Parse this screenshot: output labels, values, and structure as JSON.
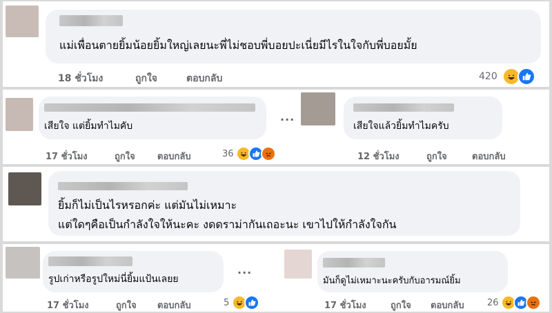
{
  "comments": [
    {
      "text": "แม่เพื่อนตายยิ้มน้อยยิ้มใหญ่เลยนะพี่ไม่ชอบพี่บอยปะเนี่ยมีไรในใจกับพี่บอยมั้ย",
      "time": "18 ชั่วโมง",
      "like": "ถูกใจ",
      "reply": "ตอบกลับ",
      "count": "420",
      "reactions": [
        "haha-icon",
        "like-icon"
      ]
    },
    {
      "text": "เสียใจ แต่ยิ้มทำไมคับ",
      "time": "17 ชั่วโมง",
      "like": "ถูกใจ",
      "reply": "ตอบกลับ",
      "count": "36",
      "reactions": [
        "haha-icon",
        "like-icon",
        "angry-icon"
      ]
    },
    {
      "text": "เสียใจแล้วยิ้มทำไมครับ",
      "time": "12 ชั่วโมง",
      "like": "ถูกใจ",
      "reply": "ตอบกลับ"
    },
    {
      "lines": [
        "ยิ้มก็ไม่เป็นไรหรอกค่ะ แต่มันไม่เหมาะ",
        "แต่ใดๆคือเป็นกำลังใจให้นะคะ งดดราม่ากันเถอะนะ เขาไปให้กำลังใจกัน"
      ]
    },
    {
      "text": "รูปเก่าหรือรูปใหม่นี่ยิ้มแป้นเลยย",
      "time": "17 ชั่วโมง",
      "like": "ถูกใจ",
      "reply": "ตอบกลับ",
      "count": "5",
      "reactions": [
        "haha-icon",
        "like-icon"
      ]
    },
    {
      "text": "มันก็ดูไม่เหมาะนะครับกับอารมณ์ยิ้ม",
      "time": "17 ชั่วโมง",
      "like": "ถูกใจ",
      "reply": "ตอบกลับ",
      "count": "26",
      "reactions": [
        "haha-icon",
        "like-icon",
        "angry-icon"
      ]
    }
  ],
  "more_options": "...",
  "colors": {
    "like": "#1877f2",
    "haha": "#f7b928",
    "angry": "#e9710f",
    "meta": "#65676b",
    "bubble": "#f0f2f5"
  }
}
